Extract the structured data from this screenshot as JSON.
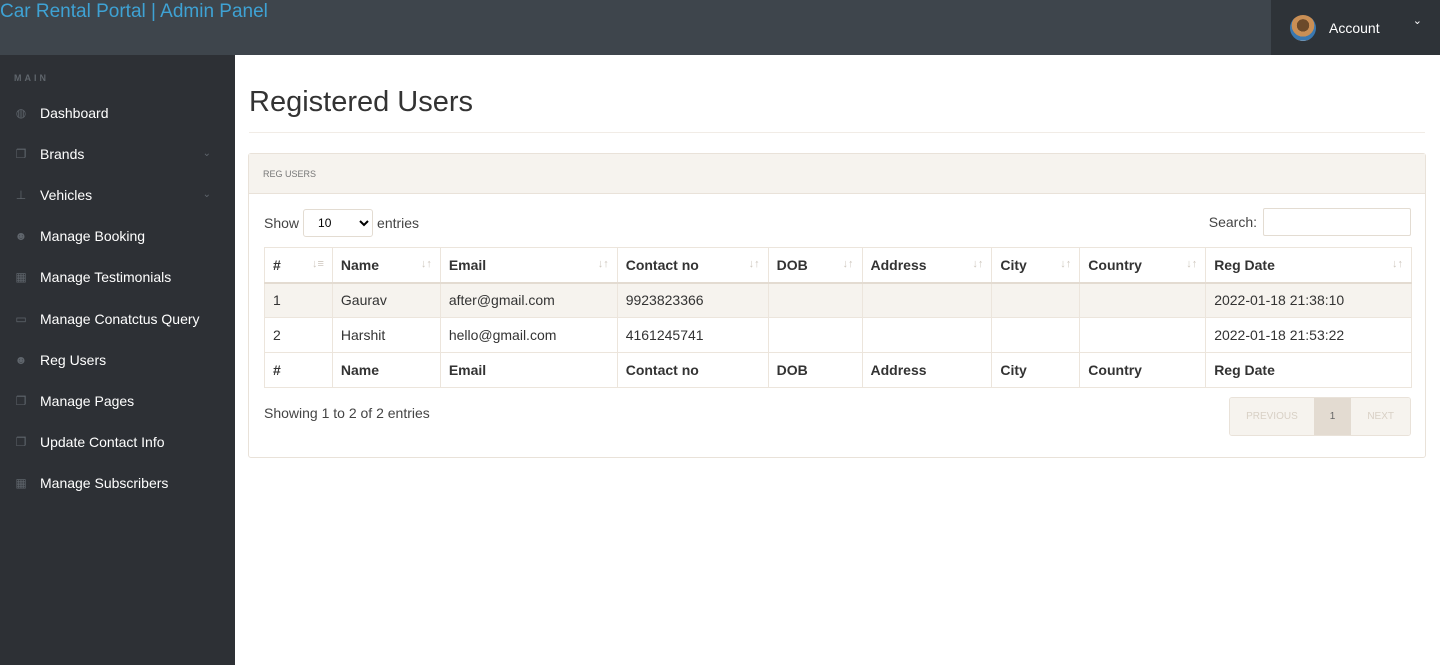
{
  "header": {
    "title": "Car Rental Portal | Admin Panel",
    "account_label": "Account"
  },
  "sidebar": {
    "section": "MAIN",
    "items": [
      {
        "label": "Dashboard",
        "icon": "dashboard-icon",
        "glyph": "◍",
        "chev": false
      },
      {
        "label": "Brands",
        "icon": "files-icon",
        "glyph": "❐",
        "chev": true
      },
      {
        "label": "Vehicles",
        "icon": "sitemap-icon",
        "glyph": "⊥",
        "chev": true
      },
      {
        "label": "Manage Booking",
        "icon": "users-icon",
        "glyph": "☻",
        "chev": false
      },
      {
        "label": "Manage Testimonials",
        "icon": "table-icon",
        "glyph": "▦",
        "chev": false
      },
      {
        "label": "Manage Conatctus Query",
        "icon": "desktop-icon",
        "glyph": "▭",
        "chev": false
      },
      {
        "label": "Reg Users",
        "icon": "users-icon",
        "glyph": "☻",
        "chev": false
      },
      {
        "label": "Manage Pages",
        "icon": "files-icon",
        "glyph": "❐",
        "chev": false
      },
      {
        "label": "Update Contact Info",
        "icon": "files-icon",
        "glyph": "❐",
        "chev": false
      },
      {
        "label": "Manage Subscribers",
        "icon": "table-icon",
        "glyph": "▦",
        "chev": false
      }
    ]
  },
  "main": {
    "title": "Registered Users",
    "panel_title": "REG USERS",
    "show_label": "Show",
    "entries_label": "entries",
    "page_length": "10",
    "search_label": "Search:",
    "search_value": "",
    "columns": [
      "#",
      "Name",
      "Email",
      "Contact no",
      "DOB",
      "Address",
      "City",
      "Country",
      "Reg Date"
    ],
    "rows": [
      [
        "1",
        "Gaurav",
        "after@gmail.com",
        "9923823366",
        "",
        "",
        "",
        "",
        "2022-01-18 21:38:10"
      ],
      [
        "2",
        "Harshit",
        "hello@gmail.com",
        "4161245741",
        "",
        "",
        "",
        "",
        "2022-01-18 21:53:22"
      ]
    ],
    "info": "Showing 1 to 2 of 2 entries",
    "pager": {
      "previous": "PREVIOUS",
      "current": "1",
      "next": "NEXT"
    }
  }
}
